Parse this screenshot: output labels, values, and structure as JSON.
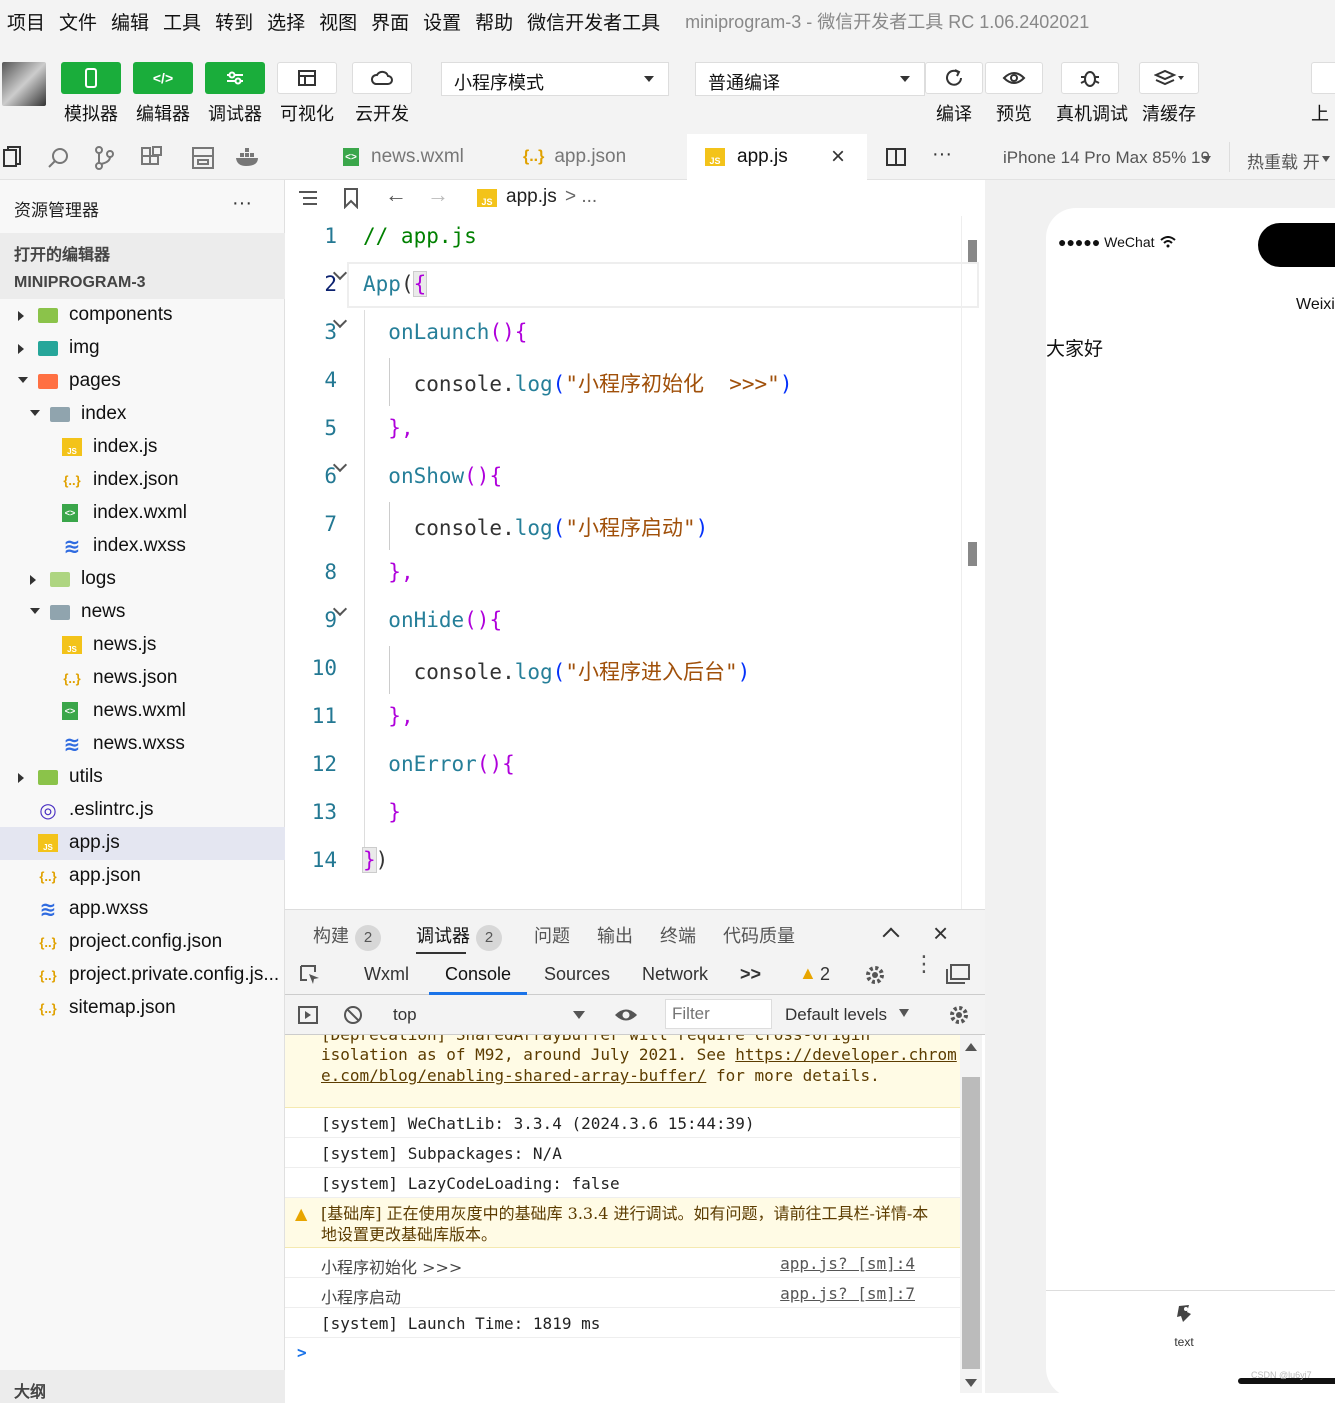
{
  "menu": {
    "items": [
      "项目",
      "文件",
      "编辑",
      "工具",
      "转到",
      "选择",
      "视图",
      "界面",
      "设置",
      "帮助",
      "微信开发者工具"
    ],
    "title": "miniprogram-3 - 微信开发者工具 RC 1.06.2402021"
  },
  "toolbar": {
    "simulator_label": "模拟器",
    "editor_label": "编辑器",
    "debugger_label": "调试器",
    "visual_label": "可视化",
    "cloud_label": "云开发",
    "mode_select": "小程序模式",
    "compile_select": "普通编译",
    "compile_label": "编译",
    "preview_label": "预览",
    "remote_debug_label": "真机调试",
    "clear_cache_label": "清缓存",
    "upload_label": "上",
    "accent": "#1aad3b"
  },
  "explorer": {
    "header": "资源管理器",
    "open_editors": "打开的编辑器",
    "project": "MINIPROGRAM-3",
    "tree": [
      {
        "name": "components",
        "type": "folder",
        "depth": 0,
        "open": false
      },
      {
        "name": "img",
        "type": "folder",
        "depth": 0,
        "open": false
      },
      {
        "name": "pages",
        "type": "folder",
        "depth": 0,
        "open": true
      },
      {
        "name": "index",
        "type": "folder",
        "depth": 1,
        "open": true
      },
      {
        "name": "index.js",
        "type": "js",
        "depth": 2
      },
      {
        "name": "index.json",
        "type": "json",
        "depth": 2
      },
      {
        "name": "index.wxml",
        "type": "wxml",
        "depth": 2
      },
      {
        "name": "index.wxss",
        "type": "wxss",
        "depth": 2
      },
      {
        "name": "logs",
        "type": "folder",
        "depth": 1,
        "open": false
      },
      {
        "name": "news",
        "type": "folder",
        "depth": 1,
        "open": true
      },
      {
        "name": "news.js",
        "type": "js",
        "depth": 2
      },
      {
        "name": "news.json",
        "type": "json",
        "depth": 2
      },
      {
        "name": "news.wxml",
        "type": "wxml",
        "depth": 2
      },
      {
        "name": "news.wxss",
        "type": "wxss",
        "depth": 2
      },
      {
        "name": "utils",
        "type": "folder",
        "depth": 0,
        "open": false
      },
      {
        "name": ".eslintrc.js",
        "type": "eslint",
        "depth": 0
      },
      {
        "name": "app.js",
        "type": "js",
        "depth": 0,
        "selected": true
      },
      {
        "name": "app.json",
        "type": "json",
        "depth": 0
      },
      {
        "name": "app.wxss",
        "type": "wxss",
        "depth": 0
      },
      {
        "name": "project.config.json",
        "type": "json",
        "depth": 0
      },
      {
        "name": "project.private.config.js...",
        "type": "json",
        "depth": 0
      },
      {
        "name": "sitemap.json",
        "type": "json",
        "depth": 0
      }
    ],
    "outline": "大纲"
  },
  "tabs": [
    {
      "label": "news.wxml",
      "type": "wxml",
      "active": false
    },
    {
      "label": "app.json",
      "type": "json",
      "active": false
    },
    {
      "label": "app.js",
      "type": "js",
      "active": true
    }
  ],
  "breadcrumb": {
    "file": "app.js",
    "rest": "> ..."
  },
  "editor": {
    "line_numbers": [
      "1",
      "2",
      "3",
      "4",
      "5",
      "6",
      "7",
      "8",
      "9",
      "10",
      "11",
      "12",
      "13",
      "14"
    ]
  },
  "panel": {
    "tabs": [
      {
        "label": "构建",
        "badge": "2"
      },
      {
        "label": "调试器",
        "badge": "2"
      },
      {
        "label": "问题"
      },
      {
        "label": "输出"
      },
      {
        "label": "终端"
      },
      {
        "label": "代码质量"
      }
    ],
    "devtools_tabs": [
      "Wxml",
      "Console",
      "Sources",
      "Network",
      ">>"
    ],
    "warning_count": "2",
    "context": "top",
    "filter_placeholder": "Filter",
    "levels": "Default levels"
  },
  "console": {
    "lines": [
      {
        "type": "warn",
        "text": "[Deprecation] SharedArrayBuffer will require cross-origin"
      },
      {
        "type": "warn",
        "text2": "isolation as of M92, around July 2021. See ",
        "link": "https://developer.chrome.com/blog/enabling-shared-array-buffer/",
        "text3": " for more details."
      },
      {
        "type": "log",
        "text": "[system] WeChatLib: 3.3.4 (2024.3.6 15:44:39)"
      },
      {
        "type": "log",
        "text": "[system] Subpackages: N/A"
      },
      {
        "type": "log",
        "text": "[system] LazyCodeLoading: false"
      },
      {
        "type": "warn",
        "text": "[基础库] 正在使用灰度中的基础库 3.3.4 进行调试。如有问题，请前往工具栏-详情-本地设置更改基础库版本。"
      },
      {
        "type": "log",
        "text": "小程序初始化  >>>",
        "src": "app.js? [sm]:4"
      },
      {
        "type": "log",
        "text": "小程序启动",
        "src": "app.js? [sm]:7"
      },
      {
        "type": "log",
        "text": "[system] Launch Time: 1819 ms"
      }
    ],
    "prompt": ">"
  },
  "simulator": {
    "device": "iPhone 14 Pro Max 85% 19",
    "hot_reload": "热重载 开",
    "status_carrier": "●●●●● WeChat",
    "nav_title": "Weixi",
    "content": "大家好",
    "tab_label": "text",
    "watermark": "CSDN @lu6yi7"
  }
}
